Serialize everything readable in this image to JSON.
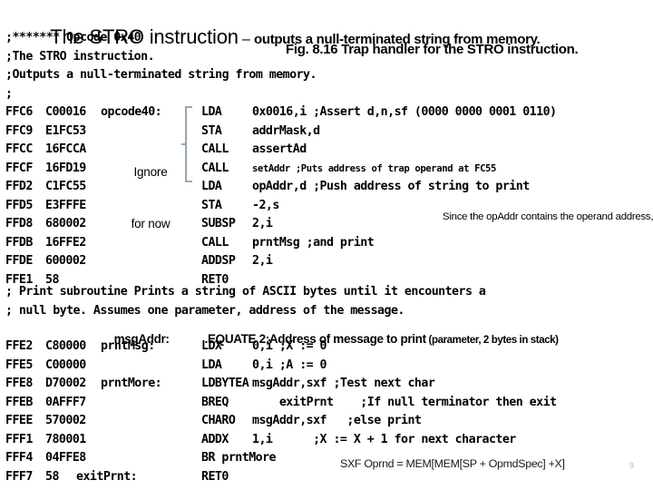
{
  "title": {
    "main": "The STRO instruction",
    "dash": " – ",
    "subtitle": "outputs a null-terminated string from memory."
  },
  "figure_caption": "Fig. 8.16 Trap handler for the STRO instruction.",
  "header_comments": [
    ";******* Opcode 0x40",
    ";The STRO instruction.",
    ";Outputs a null-terminated string from memory.",
    ";"
  ],
  "code_block_1": [
    {
      "address": "FFC6",
      "object": "C00016",
      "symbol": "opcode40:",
      "mnemonic": "LDA",
      "operand": "0x0016,i ;Assert d,n,sf (0000 0000 0001 0110)"
    },
    {
      "address": "FFC9",
      "object": "E1FC53",
      "symbol": "",
      "mnemonic": "STA",
      "operand": "addrMask,d"
    },
    {
      "address": "FFCC",
      "object": "16FCCA",
      "symbol": "",
      "mnemonic": "CALL",
      "operand": "assertAd"
    },
    {
      "address": "FFCF",
      "object": "16FD19",
      "symbol": "",
      "mnemonic": "CALL",
      "operand": "setAddr ;Puts address of trap operand at FC55",
      "operand_small": true
    },
    {
      "address": "FFD2",
      "object": "C1FC55",
      "symbol": "",
      "mnemonic": "LDA",
      "operand": "opAddr,d ;Push address of string to print"
    },
    {
      "address": "FFD5",
      "object": "E3FFFE",
      "symbol": "",
      "mnemonic": "STA",
      "operand": "-2,s"
    },
    {
      "address": "FFD8",
      "object": "680002",
      "symbol": "",
      "mnemonic": "SUBSP",
      "operand": "2,i"
    },
    {
      "address": "FFDB",
      "object": "16FFE2",
      "symbol": "",
      "mnemonic": "CALL",
      "operand": "prntMsg ;and print"
    },
    {
      "address": "FFDE",
      "object": "600002",
      "symbol": "",
      "mnemonic": "ADDSP",
      "operand": "2,i"
    },
    {
      "address": "FFE1",
      "object": "58",
      "symbol": "",
      "mnemonic": "RET0",
      "operand": ""
    }
  ],
  "ignore_note": {
    "line1": "Ignore",
    "line2": "for now",
    "bracket_color": "#7a8fa0"
  },
  "side_note": "Since the opAddr contains the operand address, it seems we could just use indirect addressing with indexing, nx or fx. We do not have that mode.",
  "middle_comments": [
    "; Print subroutine Prints a string of ASCII bytes until it encounters a",
    "; null byte. Assumes one parameter, address of the message."
  ],
  "equate_line": {
    "symbol": "msgAddr:",
    "directive": ".EQUATE 2",
    "comment": ";Address of message to print",
    "paren": " (parameter, 2 bytes in stack)"
  },
  "code_block_2": [
    {
      "address": "FFE2",
      "object": "C80000",
      "symbol": "prntMsg:",
      "mnemonic": "LDX",
      "operand": "0,i ;X := 0"
    },
    {
      "address": "FFE5",
      "object": "C00000",
      "symbol": "",
      "mnemonic": "LDA",
      "operand": "0,i ;A := 0"
    },
    {
      "address": "FFE8",
      "object": "D70002",
      "symbol": "prntMore:",
      "mnemonic": "LDBYTEA",
      "operand": "msgAddr,sxf ;Test next char"
    },
    {
      "address": "FFEB",
      "object": "0AFFF7",
      "symbol": "",
      "mnemonic": "BREQ",
      "operand": "    exitPrnt    ;If null terminator then exit"
    },
    {
      "address": "FFEE",
      "object": "570002",
      "symbol": "",
      "mnemonic": "CHARO",
      "operand": "msgAddr,sxf   ;else print"
    },
    {
      "address": "FFF1",
      "object": "780001",
      "symbol": "",
      "mnemonic": "ADDX",
      "operand": "1,i      ;X := X + 1 for next character"
    },
    {
      "address": "FFF4",
      "object": "04FFE8",
      "symbol": "",
      "mnemonic": "BR",
      "operand": "prntMore",
      "br_inline": true
    },
    {
      "address": "FFF7",
      "object": "58",
      "symbol": "exitPrnt:",
      "mnemonic": "RET0",
      "operand": "",
      "narrow": true
    }
  ],
  "footnote": "SXF Oprnd = MEM[MEM[SP + OpmdSpec] +X]",
  "page_number": "9"
}
